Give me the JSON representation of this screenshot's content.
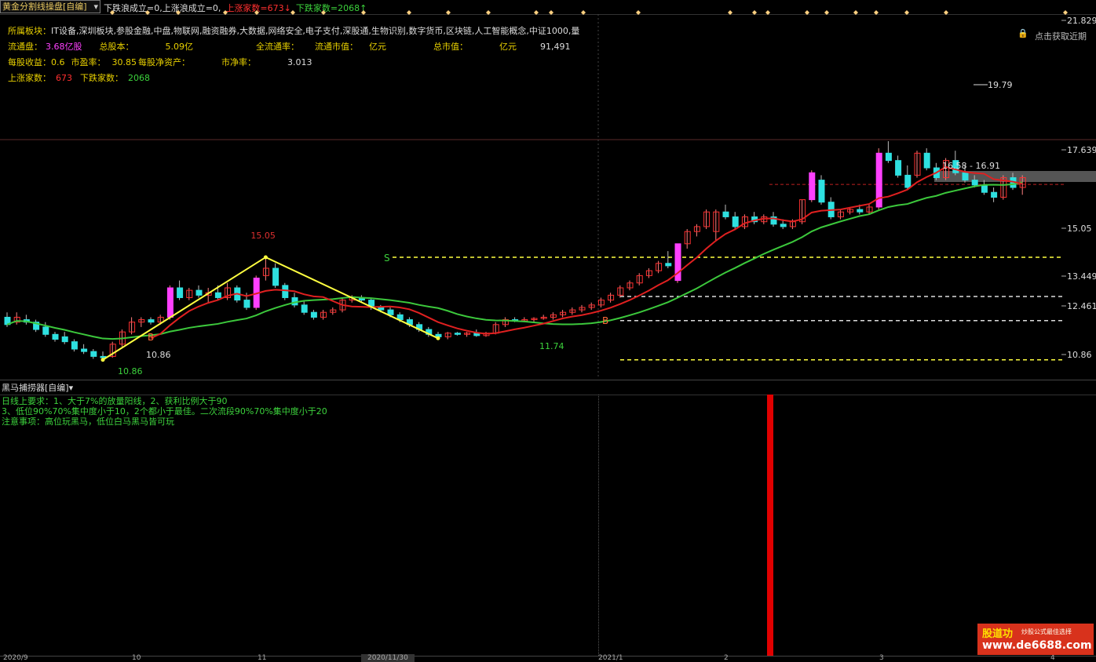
{
  "header": {
    "formula_name": "黄金分割线操盘[自编]",
    "segments": [
      {
        "text": "下跌浪成立=0,上涨浪成立=0,",
        "color": "#dddddd"
      },
      {
        "text": "上涨家数=673↓",
        "color": "#ff3030"
      },
      {
        "text": "下跌家数=2068↑",
        "color": "#3cd23c"
      }
    ]
  },
  "info": {
    "sector_label": "所属板块：",
    "sector_value": "IT设备,深圳板块,参股金融,中盘,物联网,融资融券,大数据,网络安全,电子支付,深股通,生物识别,数字货币,区块链,人工智能概念,中证1000,量",
    "row2": [
      {
        "text": "流通盘：",
        "color": "#e8d000"
      },
      {
        "text": "3.68亿股",
        "color": "#ff40ff"
      },
      {
        "text": "总股本：",
        "color": "#e8d000"
      },
      {
        "text": "5.09亿",
        "color": "#e8d000"
      },
      {
        "text": "全流通率：",
        "color": "#e8d000"
      },
      {
        "text": "流通市值：",
        "color": "#e8d000"
      },
      {
        "text": "亿元",
        "color": "#e8d000"
      },
      {
        "text": "总市值：",
        "color": "#e8d000"
      },
      {
        "text": "亿元",
        "color": "#e8d000"
      },
      {
        "text": "91,491",
        "color": "#dddddd"
      }
    ],
    "row3": [
      {
        "text": "每股收益：0.6",
        "color": "#e8d000"
      },
      {
        "text": "市盈率：",
        "color": "#e8d000"
      },
      {
        "text": "30.85",
        "color": "#e8d000"
      },
      {
        "text": "每股净资产：",
        "color": "#e8d000"
      },
      {
        "text": "市净率：",
        "color": "#e8d000"
      },
      {
        "text": "3.013",
        "color": "#dddddd"
      }
    ],
    "row4": [
      {
        "text": "上涨家数：",
        "color": "#e8d000"
      },
      {
        "text": "673",
        "color": "#ff3030"
      },
      {
        "text": "下跌家数：",
        "color": "#e8d000"
      },
      {
        "text": "2068",
        "color": "#3cd23c"
      }
    ]
  },
  "lock_text": "点击获取近期",
  "price_axis": [
    "21.829",
    "17.639",
    "15.05",
    "13.449",
    "12.461",
    "10.86"
  ],
  "chart_annotations": {
    "high_label": "19.79",
    "swing_high": "15.05",
    "swing_low1": "10.86",
    "swing_low1b": "10.86",
    "swing_low2": "11.74",
    "range_label": "16.58 - 16.91",
    "buy1": "B",
    "sell1": "S",
    "buy2": "B"
  },
  "sub_panel": {
    "indicator_name": "黑马捕捞器[自编]",
    "notes": [
      "日线上要求：1、大于7%的放量阳线，2、获利比例大于90",
      "3、低位90%70%集中度小于10，2个都小于最佳。二次流段90%70%集中度小于20",
      "注意事项：高位玩黑马，低位白马黑马皆可玩"
    ]
  },
  "bottom_axis": [
    "2020/9",
    "10",
    "11",
    "2020/11/30",
    "2021/1",
    "2",
    "3",
    "4"
  ],
  "watermark": {
    "brand": "股道功",
    "slogan": "炒股公式最佳选择",
    "url": "www.de6688.com"
  },
  "colors": {
    "up": "#ff3030",
    "down": "#2ee0e0",
    "ma_fast": "#e02020",
    "ma_slow": "#3cc83c",
    "swing_line": "#ffff40",
    "fib_line": "#ffff40"
  },
  "chart_data": {
    "type": "candlestick",
    "title": "",
    "ylim": [
      10.5,
      22.0
    ],
    "fib_levels": [
      15.05,
      13.449,
      12.461,
      10.86
    ],
    "resistance_level": 17.639,
    "candles": [
      {
        "o": 12.6,
        "h": 12.8,
        "l": 12.2,
        "c": 12.3
      },
      {
        "o": 12.4,
        "h": 12.8,
        "l": 12.3,
        "c": 12.6
      },
      {
        "o": 12.5,
        "h": 12.7,
        "l": 12.3,
        "c": 12.4
      },
      {
        "o": 12.4,
        "h": 12.5,
        "l": 12.0,
        "c": 12.1
      },
      {
        "o": 12.2,
        "h": 12.4,
        "l": 11.8,
        "c": 11.9
      },
      {
        "o": 11.9,
        "h": 12.0,
        "l": 11.6,
        "c": 11.7
      },
      {
        "o": 11.8,
        "h": 12.0,
        "l": 11.5,
        "c": 11.6
      },
      {
        "o": 11.6,
        "h": 11.7,
        "l": 11.2,
        "c": 11.3
      },
      {
        "o": 11.3,
        "h": 11.5,
        "l": 11.1,
        "c": 11.2
      },
      {
        "o": 11.2,
        "h": 11.3,
        "l": 10.9,
        "c": 11.0
      },
      {
        "o": 11.0,
        "h": 11.2,
        "l": 10.86,
        "c": 10.95
      },
      {
        "o": 11.0,
        "h": 11.6,
        "l": 10.95,
        "c": 11.5
      },
      {
        "o": 11.5,
        "h": 12.1,
        "l": 11.4,
        "c": 12.0
      },
      {
        "o": 12.0,
        "h": 12.6,
        "l": 11.9,
        "c": 12.4
      },
      {
        "o": 12.4,
        "h": 12.6,
        "l": 12.2,
        "c": 12.5
      },
      {
        "o": 12.5,
        "h": 12.6,
        "l": 12.3,
        "c": 12.4
      },
      {
        "o": 12.4,
        "h": 12.7,
        "l": 12.3,
        "c": 12.6
      },
      {
        "o": 12.6,
        "h": 13.9,
        "l": 12.5,
        "c": 13.8
      },
      {
        "o": 13.8,
        "h": 14.1,
        "l": 13.3,
        "c": 13.4
      },
      {
        "o": 13.4,
        "h": 13.8,
        "l": 13.3,
        "c": 13.7
      },
      {
        "o": 13.7,
        "h": 13.9,
        "l": 13.4,
        "c": 13.5
      },
      {
        "o": 13.5,
        "h": 13.8,
        "l": 13.2,
        "c": 13.6
      },
      {
        "o": 13.6,
        "h": 13.9,
        "l": 13.3,
        "c": 13.4
      },
      {
        "o": 13.4,
        "h": 14.0,
        "l": 13.3,
        "c": 13.8
      },
      {
        "o": 13.8,
        "h": 13.9,
        "l": 13.2,
        "c": 13.3
      },
      {
        "o": 13.3,
        "h": 13.6,
        "l": 12.9,
        "c": 13.0
      },
      {
        "o": 13.0,
        "h": 14.3,
        "l": 12.9,
        "c": 14.2
      },
      {
        "o": 14.3,
        "h": 15.05,
        "l": 14.1,
        "c": 14.6
      },
      {
        "o": 14.6,
        "h": 14.8,
        "l": 13.8,
        "c": 13.9
      },
      {
        "o": 13.9,
        "h": 14.0,
        "l": 13.3,
        "c": 13.4
      },
      {
        "o": 13.4,
        "h": 13.6,
        "l": 13.0,
        "c": 13.1
      },
      {
        "o": 13.1,
        "h": 13.3,
        "l": 12.7,
        "c": 12.8
      },
      {
        "o": 12.8,
        "h": 12.9,
        "l": 12.5,
        "c": 12.6
      },
      {
        "o": 12.6,
        "h": 12.9,
        "l": 12.5,
        "c": 12.8
      },
      {
        "o": 12.8,
        "h": 13.0,
        "l": 12.7,
        "c": 12.9
      },
      {
        "o": 12.9,
        "h": 13.4,
        "l": 12.8,
        "c": 13.3
      },
      {
        "o": 13.3,
        "h": 13.5,
        "l": 13.2,
        "c": 13.4
      },
      {
        "o": 13.4,
        "h": 13.5,
        "l": 13.2,
        "c": 13.3
      },
      {
        "o": 13.3,
        "h": 13.4,
        "l": 12.9,
        "c": 13.0
      },
      {
        "o": 13.0,
        "h": 13.1,
        "l": 12.8,
        "c": 12.9
      },
      {
        "o": 12.9,
        "h": 13.0,
        "l": 12.6,
        "c": 12.7
      },
      {
        "o": 12.7,
        "h": 12.8,
        "l": 12.4,
        "c": 12.5
      },
      {
        "o": 12.5,
        "h": 12.6,
        "l": 12.2,
        "c": 12.3
      },
      {
        "o": 12.3,
        "h": 12.4,
        "l": 12.0,
        "c": 12.1
      },
      {
        "o": 12.1,
        "h": 12.2,
        "l": 11.8,
        "c": 11.9
      },
      {
        "o": 11.9,
        "h": 12.0,
        "l": 11.74,
        "c": 11.8
      },
      {
        "o": 11.8,
        "h": 12.0,
        "l": 11.7,
        "c": 11.95
      },
      {
        "o": 11.95,
        "h": 12.0,
        "l": 11.85,
        "c": 11.9
      },
      {
        "o": 11.9,
        "h": 12.0,
        "l": 11.8,
        "c": 11.95
      },
      {
        "o": 11.95,
        "h": 12.1,
        "l": 11.8,
        "c": 11.85
      },
      {
        "o": 11.85,
        "h": 12.0,
        "l": 11.8,
        "c": 11.95
      },
      {
        "o": 11.95,
        "h": 12.4,
        "l": 11.9,
        "c": 12.3
      },
      {
        "o": 12.3,
        "h": 12.6,
        "l": 12.2,
        "c": 12.5
      },
      {
        "o": 12.5,
        "h": 12.6,
        "l": 12.4,
        "c": 12.45
      },
      {
        "o": 12.45,
        "h": 12.6,
        "l": 12.4,
        "c": 12.5
      },
      {
        "o": 12.5,
        "h": 12.6,
        "l": 12.4,
        "c": 12.55
      },
      {
        "o": 12.55,
        "h": 12.7,
        "l": 12.5,
        "c": 12.6
      },
      {
        "o": 12.6,
        "h": 12.8,
        "l": 12.5,
        "c": 12.7
      },
      {
        "o": 12.7,
        "h": 12.9,
        "l": 12.6,
        "c": 12.8
      },
      {
        "o": 12.8,
        "h": 13.0,
        "l": 12.7,
        "c": 12.9
      },
      {
        "o": 12.9,
        "h": 13.1,
        "l": 12.8,
        "c": 13.0
      },
      {
        "o": 13.0,
        "h": 13.2,
        "l": 12.9,
        "c": 13.1
      },
      {
        "o": 13.1,
        "h": 13.4,
        "l": 13.0,
        "c": 13.3
      },
      {
        "o": 13.3,
        "h": 13.6,
        "l": 13.2,
        "c": 13.5
      },
      {
        "o": 13.5,
        "h": 13.9,
        "l": 13.4,
        "c": 13.8
      },
      {
        "o": 13.8,
        "h": 14.1,
        "l": 13.7,
        "c": 14.0
      },
      {
        "o": 14.0,
        "h": 14.4,
        "l": 13.9,
        "c": 14.3
      },
      {
        "o": 14.3,
        "h": 14.6,
        "l": 14.2,
        "c": 14.5
      },
      {
        "o": 14.5,
        "h": 14.9,
        "l": 14.4,
        "c": 14.8
      },
      {
        "o": 14.8,
        "h": 15.3,
        "l": 14.6,
        "c": 14.7
      },
      {
        "o": 14.1,
        "h": 15.6,
        "l": 14.0,
        "c": 15.6
      },
      {
        "o": 15.6,
        "h": 16.2,
        "l": 15.4,
        "c": 16.1
      },
      {
        "o": 16.1,
        "h": 16.4,
        "l": 15.9,
        "c": 16.3
      },
      {
        "o": 16.3,
        "h": 17.0,
        "l": 16.2,
        "c": 16.9
      },
      {
        "o": 16.1,
        "h": 17.0,
        "l": 15.7,
        "c": 16.9
      },
      {
        "o": 16.9,
        "h": 17.2,
        "l": 16.6,
        "c": 16.7
      },
      {
        "o": 16.7,
        "h": 16.9,
        "l": 16.2,
        "c": 16.3
      },
      {
        "o": 16.3,
        "h": 16.8,
        "l": 16.2,
        "c": 16.7
      },
      {
        "o": 16.7,
        "h": 16.9,
        "l": 16.4,
        "c": 16.5
      },
      {
        "o": 16.5,
        "h": 16.8,
        "l": 16.4,
        "c": 16.7
      },
      {
        "o": 16.7,
        "h": 16.9,
        "l": 16.3,
        "c": 16.4
      },
      {
        "o": 16.4,
        "h": 16.6,
        "l": 16.2,
        "c": 16.3
      },
      {
        "o": 16.3,
        "h": 16.6,
        "l": 16.2,
        "c": 16.5
      },
      {
        "o": 16.5,
        "h": 17.4,
        "l": 16.4,
        "c": 17.4
      },
      {
        "o": 17.4,
        "h": 18.6,
        "l": 17.3,
        "c": 18.5
      },
      {
        "o": 18.2,
        "h": 18.4,
        "l": 17.2,
        "c": 17.3
      },
      {
        "o": 17.3,
        "h": 17.5,
        "l": 16.6,
        "c": 16.7
      },
      {
        "o": 16.7,
        "h": 17.0,
        "l": 16.6,
        "c": 16.9
      },
      {
        "o": 16.9,
        "h": 17.1,
        "l": 16.8,
        "c": 17.0
      },
      {
        "o": 17.0,
        "h": 17.2,
        "l": 16.8,
        "c": 16.9
      },
      {
        "o": 16.9,
        "h": 17.2,
        "l": 16.8,
        "c": 17.1
      },
      {
        "o": 17.1,
        "h": 19.5,
        "l": 17.0,
        "c": 19.3
      },
      {
        "o": 19.3,
        "h": 19.79,
        "l": 18.9,
        "c": 19.0
      },
      {
        "o": 19.0,
        "h": 19.2,
        "l": 18.3,
        "c": 18.4
      },
      {
        "o": 18.4,
        "h": 18.8,
        "l": 17.8,
        "c": 17.9
      },
      {
        "o": 18.4,
        "h": 19.4,
        "l": 18.3,
        "c": 19.3
      },
      {
        "o": 19.3,
        "h": 19.5,
        "l": 18.6,
        "c": 18.7
      },
      {
        "o": 18.7,
        "h": 18.9,
        "l": 18.2,
        "c": 18.3
      },
      {
        "o": 18.3,
        "h": 19.1,
        "l": 18.2,
        "c": 19.0
      },
      {
        "o": 19.0,
        "h": 19.4,
        "l": 18.4,
        "c": 18.5
      },
      {
        "o": 18.5,
        "h": 18.8,
        "l": 18.1,
        "c": 18.2
      },
      {
        "o": 18.2,
        "h": 18.4,
        "l": 17.9,
        "c": 18.0
      },
      {
        "o": 18.0,
        "h": 18.2,
        "l": 17.6,
        "c": 17.7
      },
      {
        "o": 17.7,
        "h": 17.9,
        "l": 17.3,
        "c": 17.5
      },
      {
        "o": 17.5,
        "h": 18.4,
        "l": 17.4,
        "c": 18.3
      },
      {
        "o": 18.3,
        "h": 18.5,
        "l": 17.8,
        "c": 17.9
      },
      {
        "o": 17.9,
        "h": 18.4,
        "l": 17.6,
        "c": 18.3
      }
    ]
  }
}
